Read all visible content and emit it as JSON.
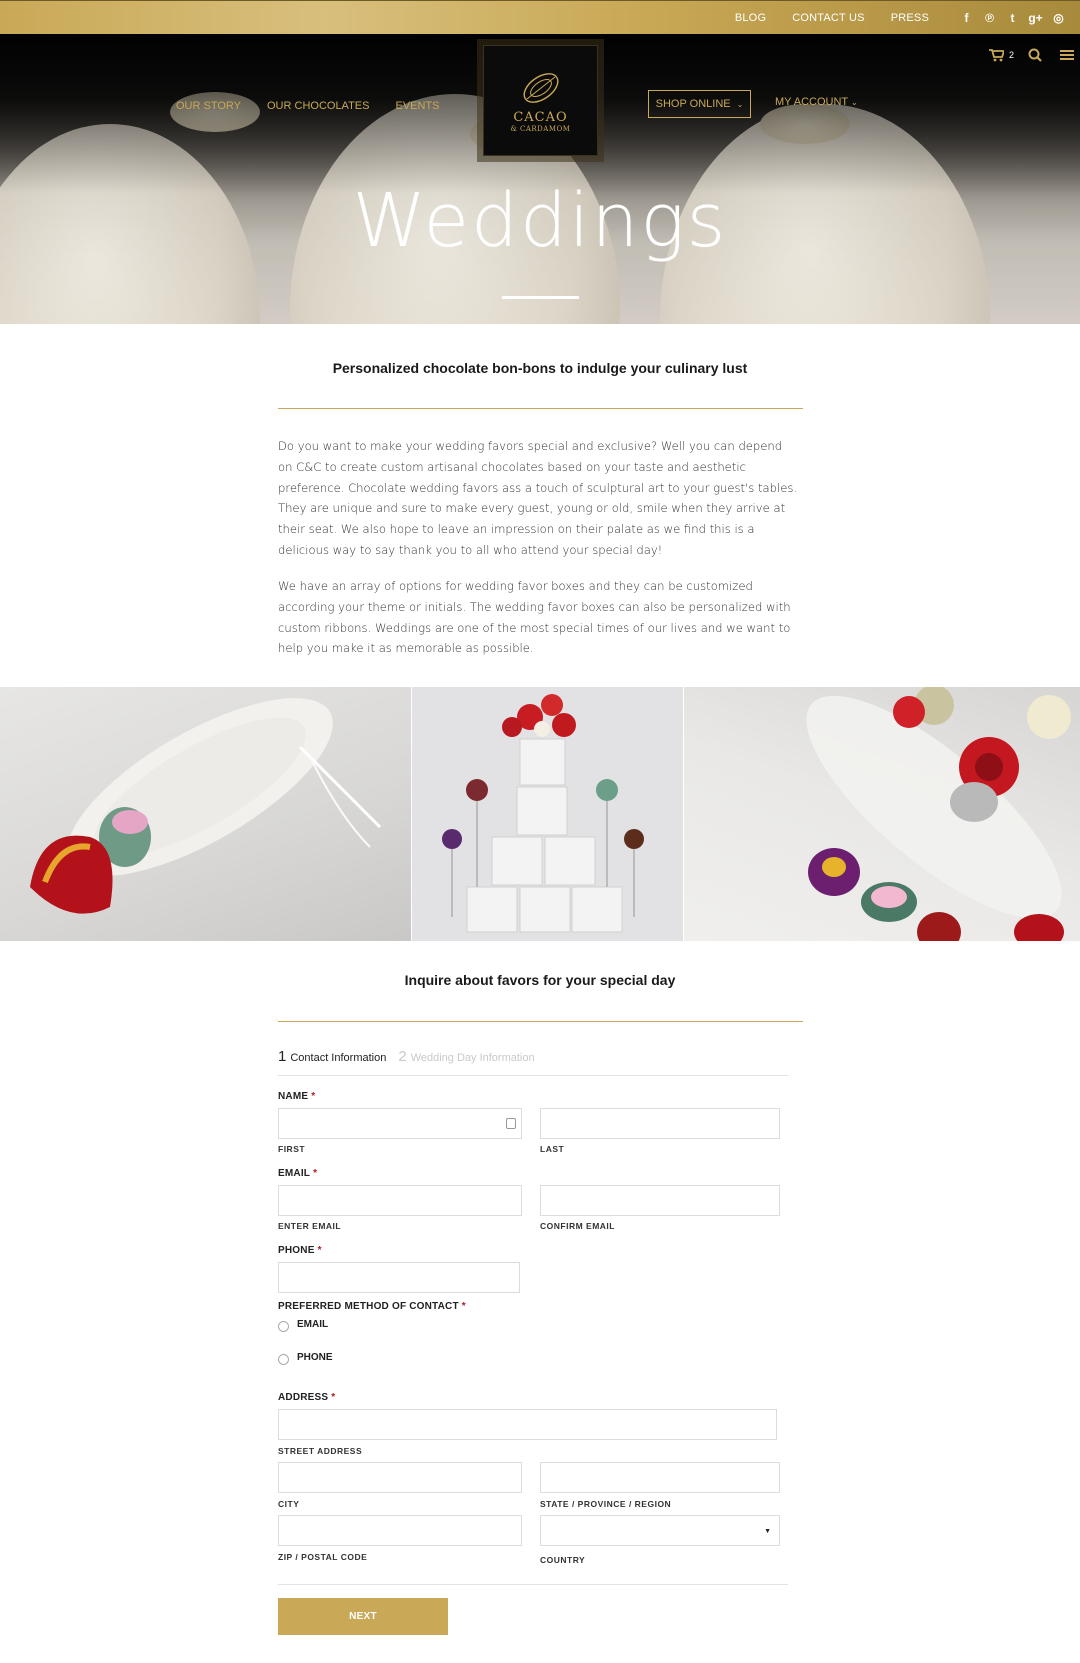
{
  "topbar": {
    "links": [
      "BLOG",
      "CONTACT US",
      "PRESS"
    ],
    "social": [
      "facebook-icon",
      "pinterest-icon",
      "twitter-icon",
      "google-plus-icon",
      "instagram-icon"
    ],
    "social_glyphs": [
      "f",
      "℗",
      "t",
      "g+",
      "◎"
    ]
  },
  "nav": {
    "left": [
      "OUR STORY",
      "OUR CHOCOLATES",
      "EVENTS"
    ],
    "shop": "SHOP ONLINE",
    "account": "MY ACCOUNT",
    "cart_count": "2"
  },
  "logo": {
    "brand": "CACAO",
    "sub": "& CARDAMOM"
  },
  "hero": {
    "title": "Weddings"
  },
  "intro": {
    "heading": "Personalized chocolate bon-bons to indulge your culinary lust",
    "paragraphs": [
      "Do you want to make your wedding favors special and exclusive? Well you can depend on C&C to create custom artisanal chocolates based on your taste and aesthetic preference. Chocolate wedding favors ass a touch of sculptural art to your guest's tables. They are unique and sure to make every guest, young or old, smile when they arrive at their seat. We also hope to leave an impression on their palate as we find this is a delicious way to say thank you to all who attend your special day!",
      "We have an array of options for wedding favor boxes and they can be customized according your theme or initials. The wedding favor boxes can also be personalized with custom ribbons. Weddings are one of the most special times of our lives and we want to help you make it as memorable as possible."
    ]
  },
  "inquire": {
    "heading": "Inquire about favors for your special day"
  },
  "form": {
    "steps": [
      {
        "num": "1",
        "label": "Contact Information"
      },
      {
        "num": "2",
        "label": "Wedding Day Information"
      }
    ],
    "name_label": "NAME",
    "first": "FIRST",
    "last": "LAST",
    "email_label": "EMAIL",
    "enter_email": "ENTER EMAIL",
    "confirm_email": "CONFIRM EMAIL",
    "phone_label": "PHONE",
    "pref_label": "PREFERRED METHOD OF CONTACT",
    "pref_options": [
      "EMAIL",
      "PHONE"
    ],
    "address_label": "ADDRESS",
    "street": "STREET ADDRESS",
    "city": "CITY",
    "state": "STATE / PROVINCE / REGION",
    "zip": "ZIP / POSTAL CODE",
    "country": "COUNTRY",
    "required_mark": "*",
    "next": "NEXT"
  },
  "colors": {
    "gold": "#c9a957",
    "required": "#b01c1c"
  }
}
